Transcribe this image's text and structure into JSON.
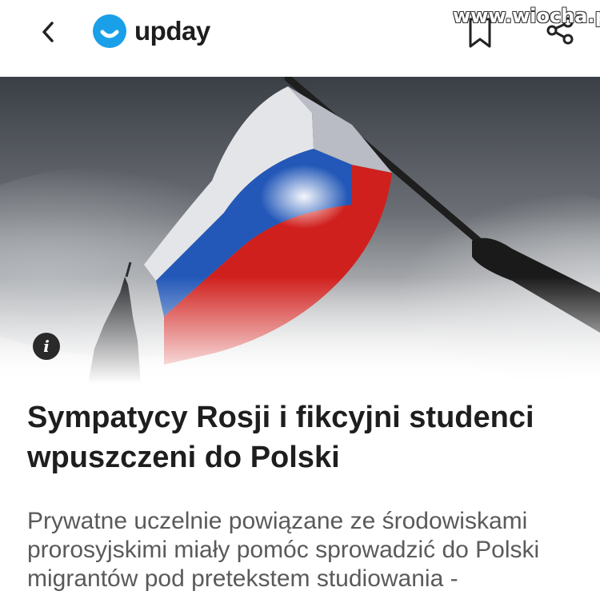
{
  "app": {
    "name": "upday",
    "brand_color": "#1aa0e8",
    "watermark": "www.wiocha.pl"
  },
  "toolbar": {
    "back_icon": "chevron-left-icon",
    "bookmark_icon": "bookmark-icon",
    "share_icon": "share-icon"
  },
  "hero": {
    "info_label": "i"
  },
  "article": {
    "headline": "Sympatycy Rosji i fikcyjni studenci wpuszczeni do Polski",
    "teaser": "Prywatne uczelnie powiązane ze środowiskami prorosyjskimi miały pomóc sprowadzić do Polski migrantów pod pretekstem studiowania -"
  }
}
